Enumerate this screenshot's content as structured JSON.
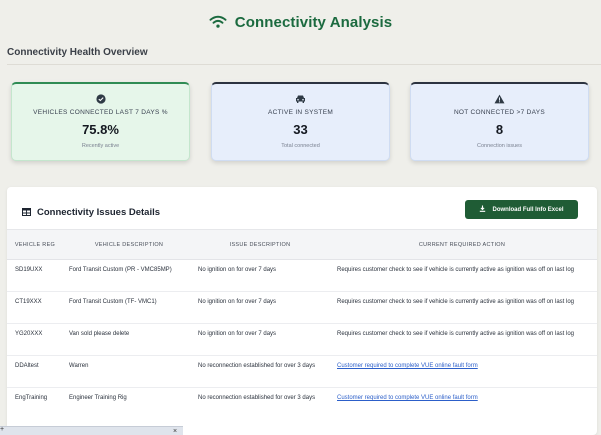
{
  "header": {
    "title": "Connectivity Analysis",
    "icon": "wifi-icon",
    "accent": "#1b6a3f"
  },
  "overview": {
    "title": "Connectivity Health Overview"
  },
  "kpis": [
    {
      "icon": "check-circle-icon",
      "label": "VEHICLES CONNECTED LAST 7 DAYS %",
      "value": "75.8%",
      "sub": "Recently active"
    },
    {
      "icon": "car-icon",
      "label": "ACTIVE IN SYSTEM",
      "value": "33",
      "sub": "Total connected"
    },
    {
      "icon": "warning-icon",
      "label": "NOT CONNECTED >7 DAYS",
      "value": "8",
      "sub": "Connection issues"
    }
  ],
  "issues": {
    "title": "Connectivity Issues Details",
    "icon": "table-icon",
    "download_label": "Download Full Info Excel",
    "download_icon": "download-icon",
    "columns": [
      "VEHICLE REG",
      "VEHICLE DESCRIPTION",
      "ISSUE DESCRIPTION",
      "CURRENT REQUIRED ACTION"
    ],
    "rows": [
      {
        "reg": "SD19UXX",
        "desc": "Ford Transit Custom (PR - VMC85MP)",
        "issue": "No ignition on for over 7 days",
        "action": "Requires customer check to see if vehicle is currently active as ignition was off on last log",
        "link": false
      },
      {
        "reg": "CT19XXX",
        "desc": "Ford Transit Custom (TF- VMC1)",
        "issue": "No ignition on for over 7 days",
        "action": "Requires customer check to see if vehicle is currently active as ignition was off on last log",
        "link": false
      },
      {
        "reg": "YG20XXX",
        "desc": "Van sold please delete",
        "issue": "No ignition on for over 7 days",
        "action": "Requires customer check to see if vehicle is currently active as ignition was off on last log",
        "link": false
      },
      {
        "reg": "DDAltest",
        "desc": "Warren",
        "issue": "No reconnection established for over 3 days",
        "action": "Customer required to complete VUE online fault form",
        "link": true
      },
      {
        "reg": "EngTraining",
        "desc": "Engineer Training Rig",
        "issue": "No reconnection established for over 3 days",
        "action": "Customer required to complete VUE online fault form",
        "link": true
      }
    ]
  },
  "bottom_bar": {
    "plus": "+",
    "close": "×"
  }
}
